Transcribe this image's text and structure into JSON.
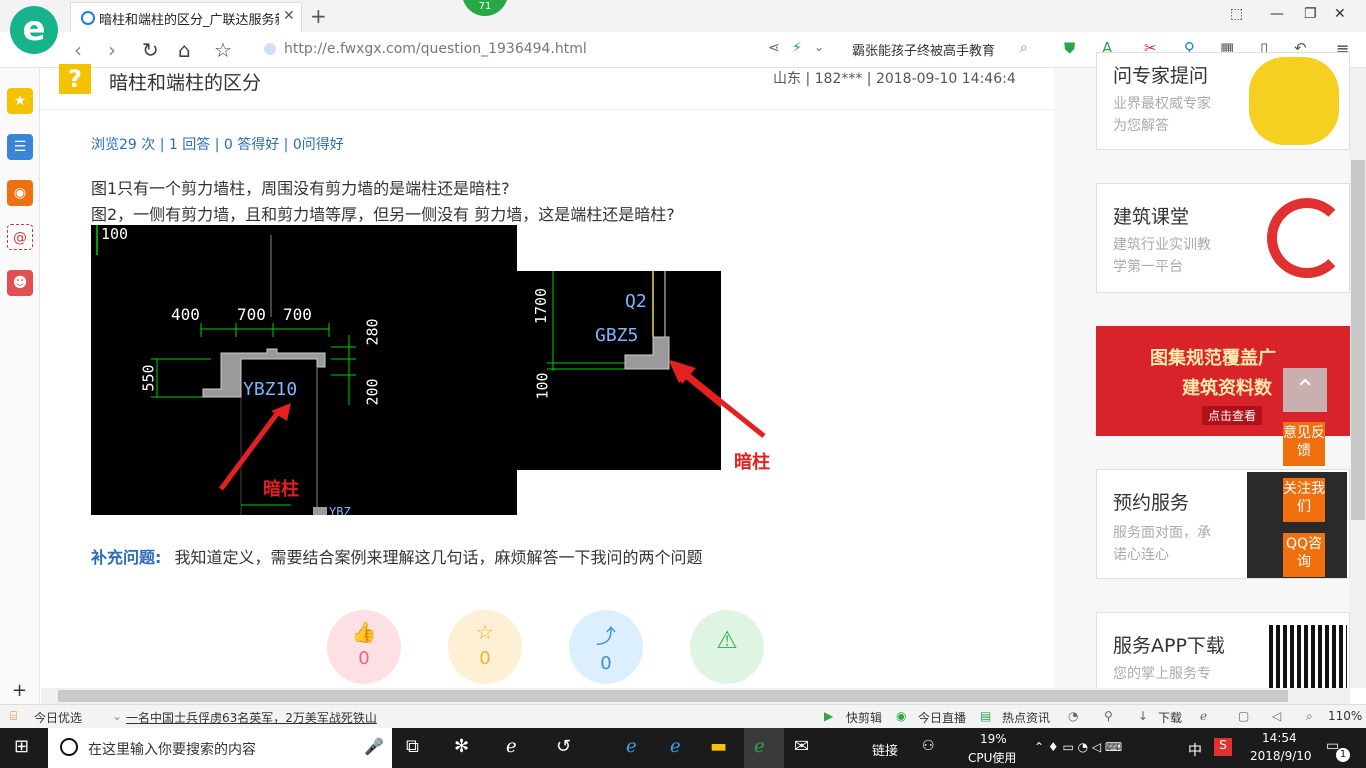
{
  "browser": {
    "tab_title": "暗柱和端柱的区分_广联达服务新",
    "badge": "71",
    "url": "http://e.fwxgx.com/question_1936494.html",
    "search_text": "霸张能孩子终被高手教育"
  },
  "question": {
    "title": "暗柱和端柱的区分",
    "meta": "山东 | 182*** | 2018-09-10 14:46:4",
    "stats": "浏览29 次 | 1 回答 | 0 答得好 | 0问得好",
    "line1": "图1只有一个剪力墙柱，周围没有剪力墙的是端柱还是暗柱?",
    "line2": "图2，一侧有剪力墙，且和剪力墙等厚，但另一侧没有 剪力墙，这是端柱还是暗柱?",
    "supp_label": "补充问题:",
    "supp_text": "我知道定义，需要结合案例来理解这几句话，麻烦解答一下我问的两个问题"
  },
  "figure1": {
    "dims_top": [
      "400",
      "700",
      "700"
    ],
    "dim_100": "100",
    "dim_550": "550",
    "dim_280": "280",
    "dim_200": "200",
    "label": "YBZ10",
    "arrow_label": "暗柱",
    "partial": "YBZ"
  },
  "figure2": {
    "dim_1700": "1700",
    "dim_100": "100",
    "label_q2": "Q2",
    "label_gbz": "GBZ5",
    "arrow_label": "暗柱"
  },
  "actions": [
    {
      "icon": "👍",
      "count": "0"
    },
    {
      "icon": "☆",
      "count": "0"
    },
    {
      "icon": "⤴",
      "count": "0"
    },
    {
      "icon": "⚠",
      "count": ""
    }
  ],
  "sidebar": {
    "card1_title": "问专家提问",
    "card1_sub1": "业界最权威专家",
    "card1_sub2": "为您解答",
    "card2_title": "建筑课堂",
    "card2_sub1": "建筑行业实训教",
    "card2_sub2": "学第一平台",
    "banner_line1": "图集规范覆盖广",
    "banner_line2": "建筑资料数",
    "banner_btn": "点击查看",
    "card3_title": "预约服务",
    "card3_sub1": "服务面对面，承",
    "card3_sub2": "诺心连心",
    "card4_title": "服务APP下载",
    "card4_sub1": "您的掌上服务专",
    "float1": "意见反馈",
    "float2": "关注我们",
    "float3": "QQ咨询"
  },
  "statusbar": {
    "today": "今日优选",
    "news": "一名中国士兵俘虏63名英军，2万美军战死铁山",
    "quick": "快剪辑",
    "live": "今日直播",
    "hot": "热点资讯",
    "download": "下载",
    "zoom": "110%"
  },
  "taskbar": {
    "search_placeholder": "在这里输入你要搜索的内容",
    "link": "链接",
    "cpu": "19%",
    "cpu_label": "CPU使用",
    "lang": "中",
    "time": "14:54",
    "date": "2018/9/10",
    "notif": "1"
  },
  "colors": {
    "accent": "#2a6db5",
    "cad_green": "#00d000",
    "cad_text": "#7fb6ff",
    "arrow_red": "#e52020",
    "orange": "#f07010"
  }
}
